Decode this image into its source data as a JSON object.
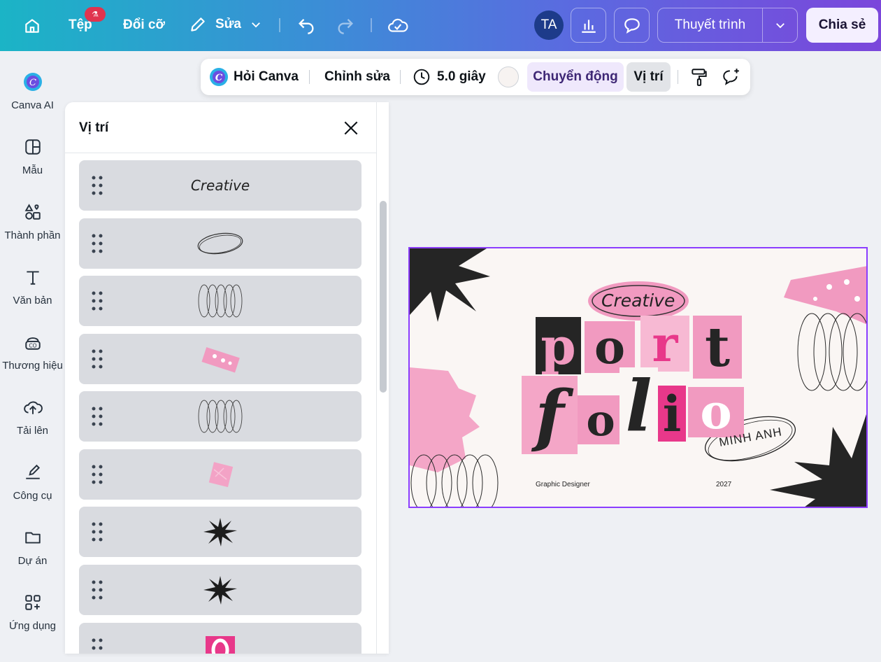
{
  "topbar": {
    "file_label": "Tệp",
    "file_badge": "⚗",
    "resize_label": "Đổi cỡ",
    "edit_label": "Sửa",
    "avatar_initials": "TA",
    "present_label": "Thuyết trình",
    "share_label": "Chia sẻ"
  },
  "rail": {
    "items": [
      {
        "label": "Canva AI"
      },
      {
        "label": "Mẫu"
      },
      {
        "label": "Thành phần"
      },
      {
        "label": "Văn bản"
      },
      {
        "label": "Thương hiệu"
      },
      {
        "label": "Tải lên"
      },
      {
        "label": "Công cụ"
      },
      {
        "label": "Dự án"
      },
      {
        "label": "Ứng dụng"
      }
    ]
  },
  "toolbar": {
    "ask_canva": "Hỏi Canva",
    "edit": "Chỉnh sửa",
    "duration": "5.0 giây",
    "animate": "Chuyển động",
    "position": "Vị trí"
  },
  "panel": {
    "title": "Vị trí",
    "layers": [
      {
        "kind": "text",
        "text": "Creative"
      },
      {
        "kind": "ellipse"
      },
      {
        "kind": "rings"
      },
      {
        "kind": "pink-tape"
      },
      {
        "kind": "rings"
      },
      {
        "kind": "pink-stamp"
      },
      {
        "kind": "starburst"
      },
      {
        "kind": "starburst"
      },
      {
        "kind": "pink-letter"
      }
    ]
  },
  "design": {
    "creative": "Creative",
    "word1": [
      "p",
      "o",
      "r",
      "t"
    ],
    "word2": [
      "f",
      "o",
      "l",
      "i",
      "o"
    ],
    "name": "MINH ANH",
    "role": "Graphic Designer",
    "year": "2027"
  },
  "colors": {
    "accent": "#8b3dff",
    "pink": "#f19ac0",
    "hot_pink": "#e8388a",
    "dark": "#2a2a2a"
  }
}
